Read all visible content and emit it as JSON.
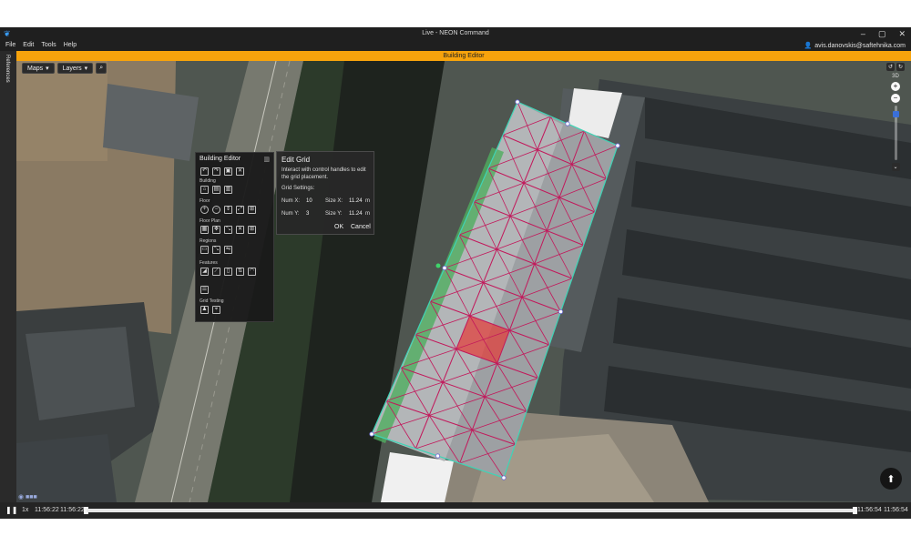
{
  "window": {
    "title": "Live - NEON Command",
    "controls": [
      "–",
      "▢",
      "✕"
    ]
  },
  "menu": {
    "items": [
      "File",
      "Edit",
      "Tools",
      "Help"
    ],
    "user_email": "avis.danovskis@saftehnika.com"
  },
  "sidebar": {
    "label": "References"
  },
  "mode_banner": {
    "label": "Building Editor",
    "color": "#f7a30c"
  },
  "map": {
    "maps_label": "Maps",
    "layers_label": "Layers",
    "mode_label": "3D",
    "zoom_in": "+",
    "zoom_out": "−",
    "zoom_level": 0.88,
    "compass_label": "⬆",
    "grid_line_color": "#c2185b",
    "grid_border_color": "#3fd4b6",
    "selected_cell_color": "#e53935"
  },
  "building_editor": {
    "title": "Building Editor",
    "sections": {
      "building": "Building",
      "floor": "Floor",
      "floor_plan": "Floor Plan",
      "regions": "Regions",
      "features": "Features",
      "grid_testing": "Grid Testing"
    }
  },
  "edit_grid": {
    "title": "Edit Grid",
    "description": "Interact with control handles to edit the grid placement.",
    "settings_label": "Grid Settings:",
    "num_x_label": "Num X:",
    "num_x_value": "10",
    "num_y_label": "Num Y:",
    "num_y_value": "3",
    "size_x_label": "Size X:",
    "size_x_value": "11.24",
    "size_y_label": "Size Y:",
    "size_y_value": "11.24",
    "unit": "m",
    "ok_label": "OK",
    "cancel_label": "Cancel"
  },
  "timeline": {
    "speed": "1x",
    "start_time": "11:56:22",
    "start_time_2": "11:56:22",
    "end_time": "11:56:54",
    "end_time_2": "11:56:54"
  }
}
